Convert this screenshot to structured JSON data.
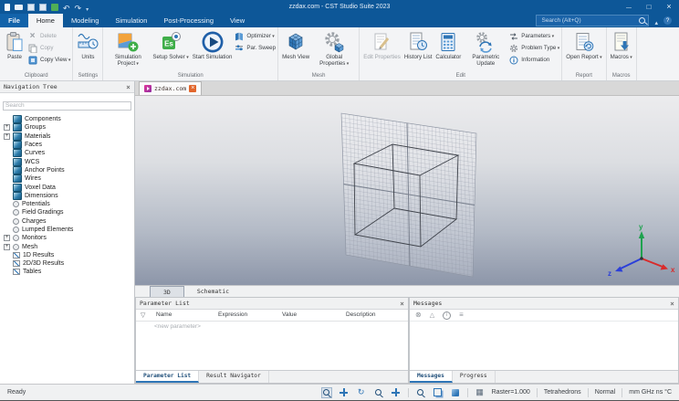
{
  "window": {
    "title": "zzdax.com - CST Studio Suite 2023",
    "search_placeholder": "Search (Alt+Q)"
  },
  "tabs": {
    "file": "File",
    "home": "Home",
    "modeling": "Modeling",
    "simulation": "Simulation",
    "post_processing": "Post-Processing",
    "view": "View"
  },
  "ribbon": {
    "paste": "Paste",
    "delete": "Delete",
    "copy": "Copy",
    "copy_view": "Copy View",
    "units": "Units",
    "simulation_project": "Simulation Project",
    "setup_solver": "Setup Solver",
    "start_simulation": "Start Simulation",
    "optimizer": "Optimizer",
    "par_sweep": "Par. Sweep",
    "mesh_view": "Mesh View",
    "global_properties": "Global Properties",
    "edit_properties": "Edit Properties",
    "history_list": "History List",
    "calculator": "Calculator",
    "parametric_update": "Parametric Update",
    "parameters": "Parameters",
    "problem_type": "Problem Type",
    "information": "Information",
    "open_report": "Open Report",
    "macros": "Macros",
    "groups": {
      "clipboard": "Clipboard",
      "settings": "Settings",
      "simulation": "Simulation",
      "mesh": "Mesh",
      "edit": "Edit",
      "report": "Report",
      "macros": "Macros"
    }
  },
  "nav": {
    "title": "Navigation Tree",
    "search_placeholder": "Search",
    "items": [
      "Components",
      "Groups",
      "Materials",
      "Faces",
      "Curves",
      "WCS",
      "Anchor Points",
      "Wires",
      "Voxel Data",
      "Dimensions",
      "Potentials",
      "Field Gradings",
      "Charges",
      "Lumped Elements",
      "Monitors",
      "Mesh",
      "1D Results",
      "2D/3D Results",
      "Tables"
    ]
  },
  "doc": {
    "tab": "zzdax.com",
    "view_tab_3d": "3D",
    "view_tab_schematic": "Schematic",
    "axis_x": "x",
    "axis_y": "y",
    "axis_z": "z"
  },
  "params": {
    "title": "Parameter List",
    "col_name": "Name",
    "col_expression": "Expression",
    "col_value": "Value",
    "col_description": "Description",
    "new_parameter": "<new parameter>",
    "tab_parameter_list": "Parameter List",
    "tab_result_navigator": "Result Navigator"
  },
  "messages": {
    "title": "Messages",
    "tab_messages": "Messages",
    "tab_progress": "Progress"
  },
  "status": {
    "ready": "Ready",
    "raster": "Raster=1.000",
    "mesh": "Tetrahedrons",
    "mode": "Normal",
    "units": "mm GHz ns °C"
  },
  "colors": {
    "titlebar": "#0d5798",
    "accent": "#2e75b6",
    "axis_x": "#d92b2b",
    "axis_y": "#1fa24e",
    "axis_z": "#2b3fd9"
  }
}
